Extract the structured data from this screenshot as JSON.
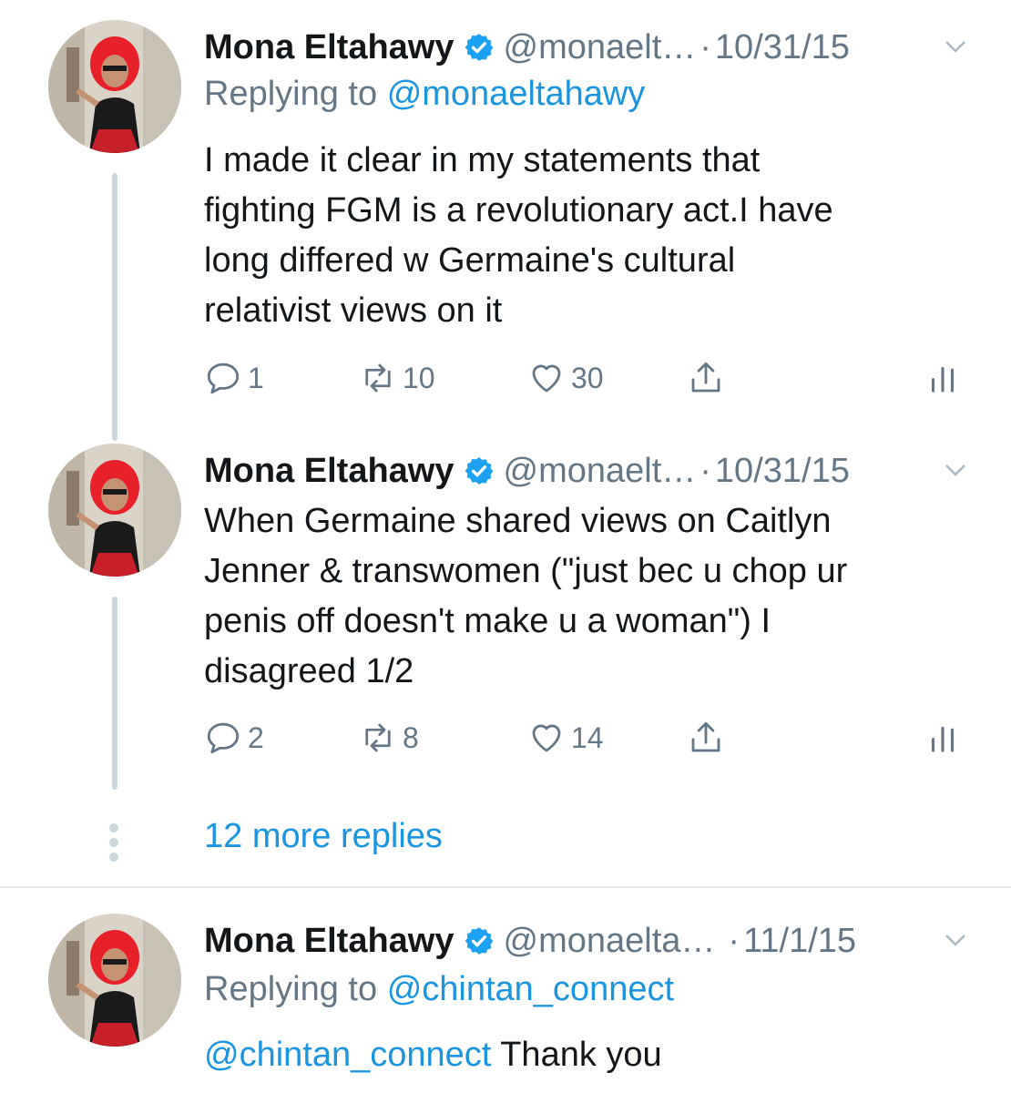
{
  "tweets": [
    {
      "name": "Mona Eltahawy",
      "handle": "@monaelt…",
      "dot": "·",
      "date": "10/31/15",
      "reply_prefix": "Replying to",
      "reply_to": "@monaeltahawy",
      "text_lines": [
        "I made it clear in my statements that",
        "fighting FGM is a revolutionary act.I have",
        "long differed w Germaine's cultural",
        "relativist views on it"
      ],
      "replies": "1",
      "retweets": "10",
      "likes": "30"
    },
    {
      "name": "Mona Eltahawy",
      "handle": "@monaelt…",
      "dot": "·",
      "date": "10/31/15",
      "text_lines": [
        "When Germaine shared views on Caitlyn",
        "Jenner & transwomen (\"just bec u chop ur",
        "penis off doesn't make u a woman\") I",
        "disagreed 1/2"
      ],
      "replies": "2",
      "retweets": "8",
      "likes": "14"
    },
    {
      "name": "Mona Eltahawy",
      "handle": "@monaelta…",
      "dot": "·",
      "date": "11/1/15",
      "reply_prefix": "Replying to",
      "reply_to": "@chintan_connect",
      "mention": "@chintan_connect",
      "text": "Thank you"
    }
  ],
  "more_replies": "12 more replies",
  "icons": {
    "verified": "verified-badge-icon",
    "caret": "chevron-down-icon",
    "reply": "reply-icon",
    "retweet": "retweet-icon",
    "like": "heart-icon",
    "share": "share-icon",
    "analytics": "analytics-icon"
  },
  "colors": {
    "link": "#1b95e0",
    "secondary": "#657786",
    "thread_line": "#ccd6dd",
    "avatar_hair": "#e8202a"
  }
}
